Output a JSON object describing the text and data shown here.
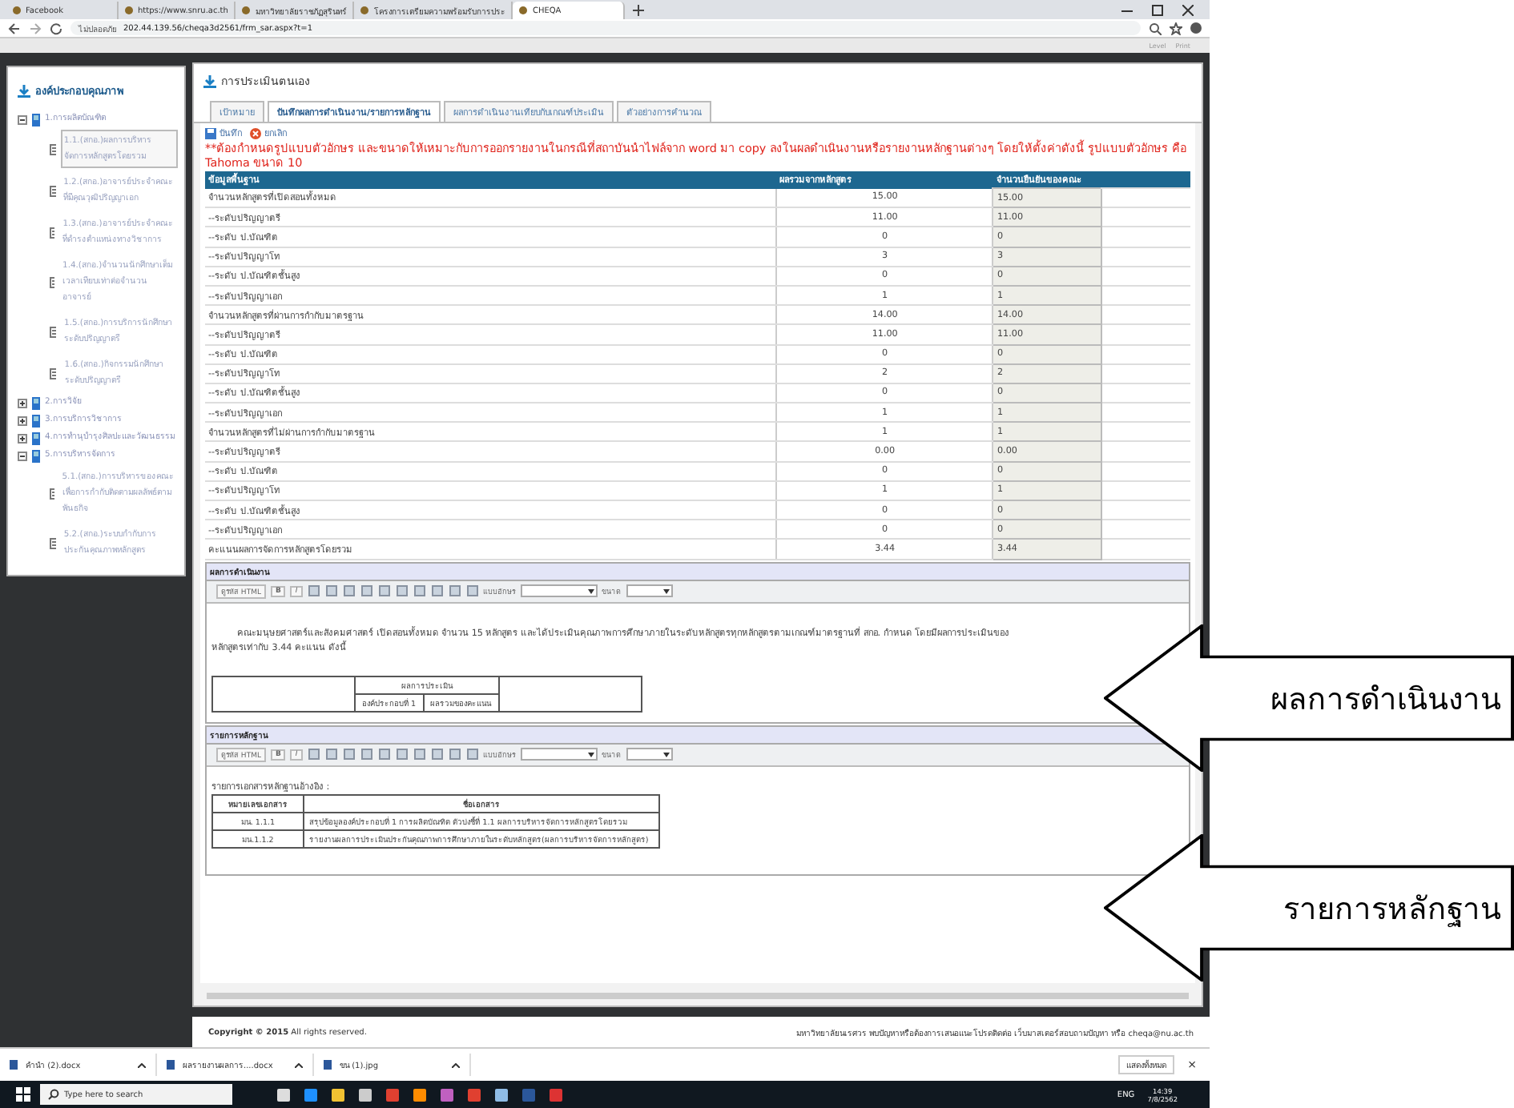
{
  "browser": {
    "tabs": [
      {
        "title": "Facebook",
        "selected": false
      },
      {
        "title": "https://www.snru.ac.th",
        "selected": false
      },
      {
        "title": "มหาวิทยาลัยราชภัฏสุรินทร์",
        "selected": false
      },
      {
        "title": "โครงการเตรียมความพร้อมรับการประ",
        "selected": false
      },
      {
        "title": "CHEQA",
        "selected": true
      }
    ],
    "security": "ไม่ปลอดภัย",
    "url": "202.44.139.56/cheqa3d2561/frm_sar.aspx?t=1"
  },
  "top_links": [
    "Level",
    "Print"
  ],
  "sidebar": {
    "title": "องค์ประกอบคุณภาพ",
    "items": [
      {
        "label": "1.การผลิตบัณฑิต",
        "expanded": true,
        "children": [
          {
            "label": "1.1.(สกอ.)ผลการบริหารจัดการหลักสูตรโดยรวม",
            "selected": true
          },
          {
            "label": "1.2.(สกอ.)อาจารย์ประจำคณะที่มีคุณวุฒิปริญญาเอก",
            "selected": false
          },
          {
            "label": "1.3.(สกอ.)อาจารย์ประจำคณะที่ดำรงตำแหน่งทางวิชาการ",
            "selected": false
          },
          {
            "label": "1.4.(สกอ.)จำนวนนักศึกษาเต็มเวลาเทียบเท่าต่อจำนวนอาจารย์",
            "selected": false
          },
          {
            "label": "1.5.(สกอ.)การบริการนักศึกษาระดับปริญญาตรี",
            "selected": false
          },
          {
            "label": "1.6.(สกอ.)กิจกรรมนักศึกษาระดับปริญญาตรี",
            "selected": false
          }
        ]
      },
      {
        "label": "2.การวิจัย",
        "expanded": false
      },
      {
        "label": "3.การบริการวิชาการ",
        "expanded": false
      },
      {
        "label": "4.การทำนุบำรุงศิลปะและวัฒนธรรม",
        "expanded": false
      },
      {
        "label": "5.การบริหารจัดการ",
        "expanded": true,
        "children": [
          {
            "label": "5.1.(สกอ.)การบริหารของคณะเพื่อการกำกับติดตามผลลัพธ์ตามพันธกิจ",
            "selected": false
          },
          {
            "label": "5.2.(สกอ.)ระบบกำกับการประกันคุณภาพหลักสูตร",
            "selected": false
          }
        ]
      }
    ]
  },
  "main": {
    "title": "การประเมินตนเอง",
    "tabs": [
      {
        "label": "เป้าหมาย",
        "selected": false
      },
      {
        "label": "บันทึกผลการดำเนินงาน/รายการหลักฐาน",
        "selected": true
      },
      {
        "label": "ผลการดำเนินงานเทียบกับเกณฑ์ประเมิน",
        "selected": false
      },
      {
        "label": "ตัวอย่างการคำนวณ",
        "selected": false
      }
    ],
    "save": "บันทึก",
    "cancel": "ยกเลิก",
    "notice": "**ต้องกำหนดรูปแบบตัวอักษร และขนาดให้เหมาะกับการออกรายงานในกรณีที่สถาบันนำไฟล์จาก word มา copy ลงในผลดำเนินงานหรือรายงานหลักฐานต่างๆ โดยให้ตั้งค่าดังนี้ รูปแบบตัวอักษร คือ Tahoma ขนาด 10",
    "table": {
      "columns": [
        "ข้อมูลพื้นฐาน",
        "ผลรวมจากหลักสูตร",
        "จำนวนยืนยันของคณะ"
      ],
      "rows": [
        [
          "จำนวนหลักสูตรที่เปิดสอนทั้งหมด",
          "15.00",
          "15.00"
        ],
        [
          "--ระดับปริญญาตรี",
          "11.00",
          "11.00"
        ],
        [
          "--ระดับ ป.บัณฑิต",
          "0",
          "0"
        ],
        [
          "--ระดับปริญญาโท",
          "3",
          "3"
        ],
        [
          "--ระดับ ป.บัณฑิตชั้นสูง",
          "0",
          "0"
        ],
        [
          "--ระดับปริญญาเอก",
          "1",
          "1"
        ],
        [
          "จำนวนหลักสูตรที่ผ่านการกำกับมาตรฐาน",
          "14.00",
          "14.00"
        ],
        [
          "--ระดับปริญญาตรี",
          "11.00",
          "11.00"
        ],
        [
          "--ระดับ ป.บัณฑิต",
          "0",
          "0"
        ],
        [
          "--ระดับปริญญาโท",
          "2",
          "2"
        ],
        [
          "--ระดับ ป.บัณฑิตชั้นสูง",
          "0",
          "0"
        ],
        [
          "--ระดับปริญญาเอก",
          "1",
          "1"
        ],
        [
          "จำนวนหลักสูตรที่ไม่ผ่านการกำกับมาตรฐาน",
          "1",
          "1"
        ],
        [
          "--ระดับปริญญาตรี",
          "0.00",
          "0.00"
        ],
        [
          "--ระดับ ป.บัณฑิต",
          "0",
          "0"
        ],
        [
          "--ระดับปริญญาโท",
          "1",
          "1"
        ],
        [
          "--ระดับ ป.บัณฑิตชั้นสูง",
          "0",
          "0"
        ],
        [
          "--ระดับปริญญาเอก",
          "0",
          "0"
        ],
        [
          "คะแนนผลการจัดการหลักสูตรโดยรวม",
          "3.44",
          "3.44"
        ]
      ]
    },
    "results": {
      "heading": "ผลการดำเนินงาน",
      "toolbar": {
        "html": "ดูรหัส HTML",
        "bold": "B",
        "italic": "I",
        "font": "แบบอักษร",
        "size": "ขนาด"
      },
      "paragraph_1": "คณะมนุษยศาสตร์และสังคมศาสตร์ เปิดสอนทั้งหมด จำนวน 15 หลักสูตร และได้ประเมินคุณภาพการศึกษาภายในระดับหลักสูตรทุกหลักสูตรตามเกณฑ์มาตรฐานที่ สกอ. กำหนด โดยมีผลการประเมินของ",
      "paragraph_2": "หลักสูตรเท่ากับ 3.44 คะแนน ดังนี้",
      "table_header": "ผลการประเมิน",
      "table_subheaders": [
        "องค์ประกอบที่ 1",
        "ผลรวมของคะแนน"
      ]
    },
    "evidence": {
      "heading": "รายการหลักฐาน",
      "toolbar": {
        "html": "ดูรหัส HTML",
        "bold": "B",
        "italic": "I",
        "font": "แบบอักษร",
        "size": "ขนาด"
      },
      "caption": "รายการเอกสารหลักฐานอ้างอิง :",
      "columns": [
        "หมายเลขเอกสาร",
        "ชื่อเอกสาร"
      ],
      "rows": [
        [
          "มน. 1.1.1",
          "สรุปข้อมูลองค์ประกอบที่ 1 การผลิตบัณฑิต ตัวบ่งชี้ที่ 1.1 ผลการบริหารจัดการหลักสูตรโดยรวม"
        ],
        [
          "มน.1.1.2",
          "รายงานผลการประเมินประกันคุณภาพการศึกษาภายในระดับหลักสูตร(ผลการบริหารจัดการหลักสูตร)"
        ]
      ]
    }
  },
  "footer": {
    "copyright": "**Copyright © 2015** All rights reserved.",
    "contact": "มหาวิทยาลัยนเรศวร พบปัญหาหรือต้องการเสนอแนะโปรดติดต่อ เว็บมาสเตอร์สอบถามปัญหา หรือ cheqa@nu.ac.th"
  },
  "downloads": {
    "items": [
      "คำนำ (2).docx",
      "ผลรายงานผลการ....docx",
      "ขน (1).jpg"
    ],
    "show_all": "แสดงทั้งหมด",
    "close": "×"
  },
  "taskbar": {
    "search": "Type here to search",
    "lang": "ENG",
    "time": "14:39",
    "date": "7/8/2562"
  },
  "callouts": [
    "ผลการดำเนินงาน",
    "รายการหลักฐาน"
  ]
}
